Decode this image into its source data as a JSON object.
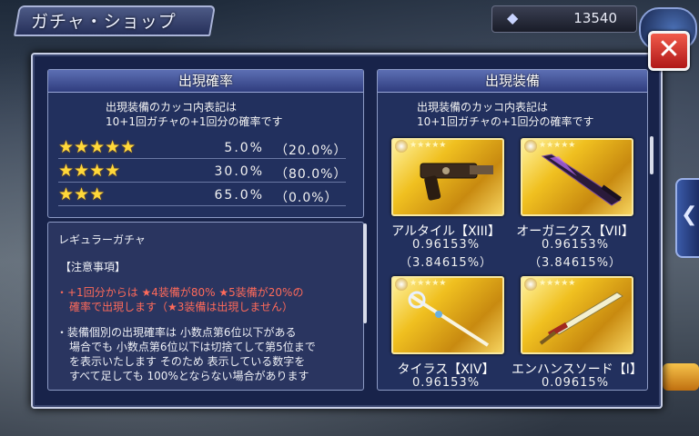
{
  "header": {
    "title": "ガチャ・ショップ",
    "gem_count": "13540"
  },
  "close_label": "✕",
  "rate_section": {
    "heading": "出現確率",
    "desc_line1": "出現装備のカッコ内表記は",
    "desc_line2": "10+1回ガチャの+1回分の確率です",
    "rows": [
      {
        "stars": "★★★★★",
        "rate": "5.0%",
        "rate_plus1": "（20.0%）"
      },
      {
        "stars": "★★★★",
        "rate": "30.0%",
        "rate_plus1": "（80.0%）"
      },
      {
        "stars": "★★★",
        "rate": "65.0%",
        "rate_plus1": "（0.0%）"
      }
    ]
  },
  "notes": {
    "gacha_name": "レギュラーガチャ",
    "caution_title": "【注意事項】",
    "bullet1_line1": "・+1回分からは ★4装備が80% ★5装備が20%の",
    "bullet1_line2": "確率で出現します（★3装備は出現しません）",
    "bullet2_line1": "・装備個別の出現確率は 小数点第6位以下がある",
    "bullet2_line2": "場合でも 小数点第6位以下は切捨てして第5位まで",
    "bullet2_line3": "を表示いたします そのため 表示している数字を",
    "bullet2_line4": "すべて足しても 100%とならない場合があります"
  },
  "equip_section": {
    "heading": "出現装備",
    "desc_line1": "出現装備のカッコ内表記は",
    "desc_line2": "10+1回ガチャの+1回分の確率です",
    "items": [
      {
        "name": "アルタイル【XIII】",
        "rate": "0.96153%",
        "rate_plus1": "（3.84615%）",
        "stars": "★★★★★",
        "icon": "gunblade-icon"
      },
      {
        "name": "オーガニクス【VII】",
        "rate": "0.96153%",
        "rate_plus1": "（3.84615%）",
        "stars": "★★★★★",
        "icon": "dark-sword-icon"
      },
      {
        "name": "タイラス【XIV】",
        "rate": "0.96153%",
        "rate_plus1": "",
        "stars": "★★★★★",
        "icon": "staff-icon"
      },
      {
        "name": "エンハンスソード【I】",
        "rate": "0.09615%",
        "rate_plus1": "",
        "stars": "★★★★★",
        "icon": "sword-icon"
      }
    ]
  }
}
